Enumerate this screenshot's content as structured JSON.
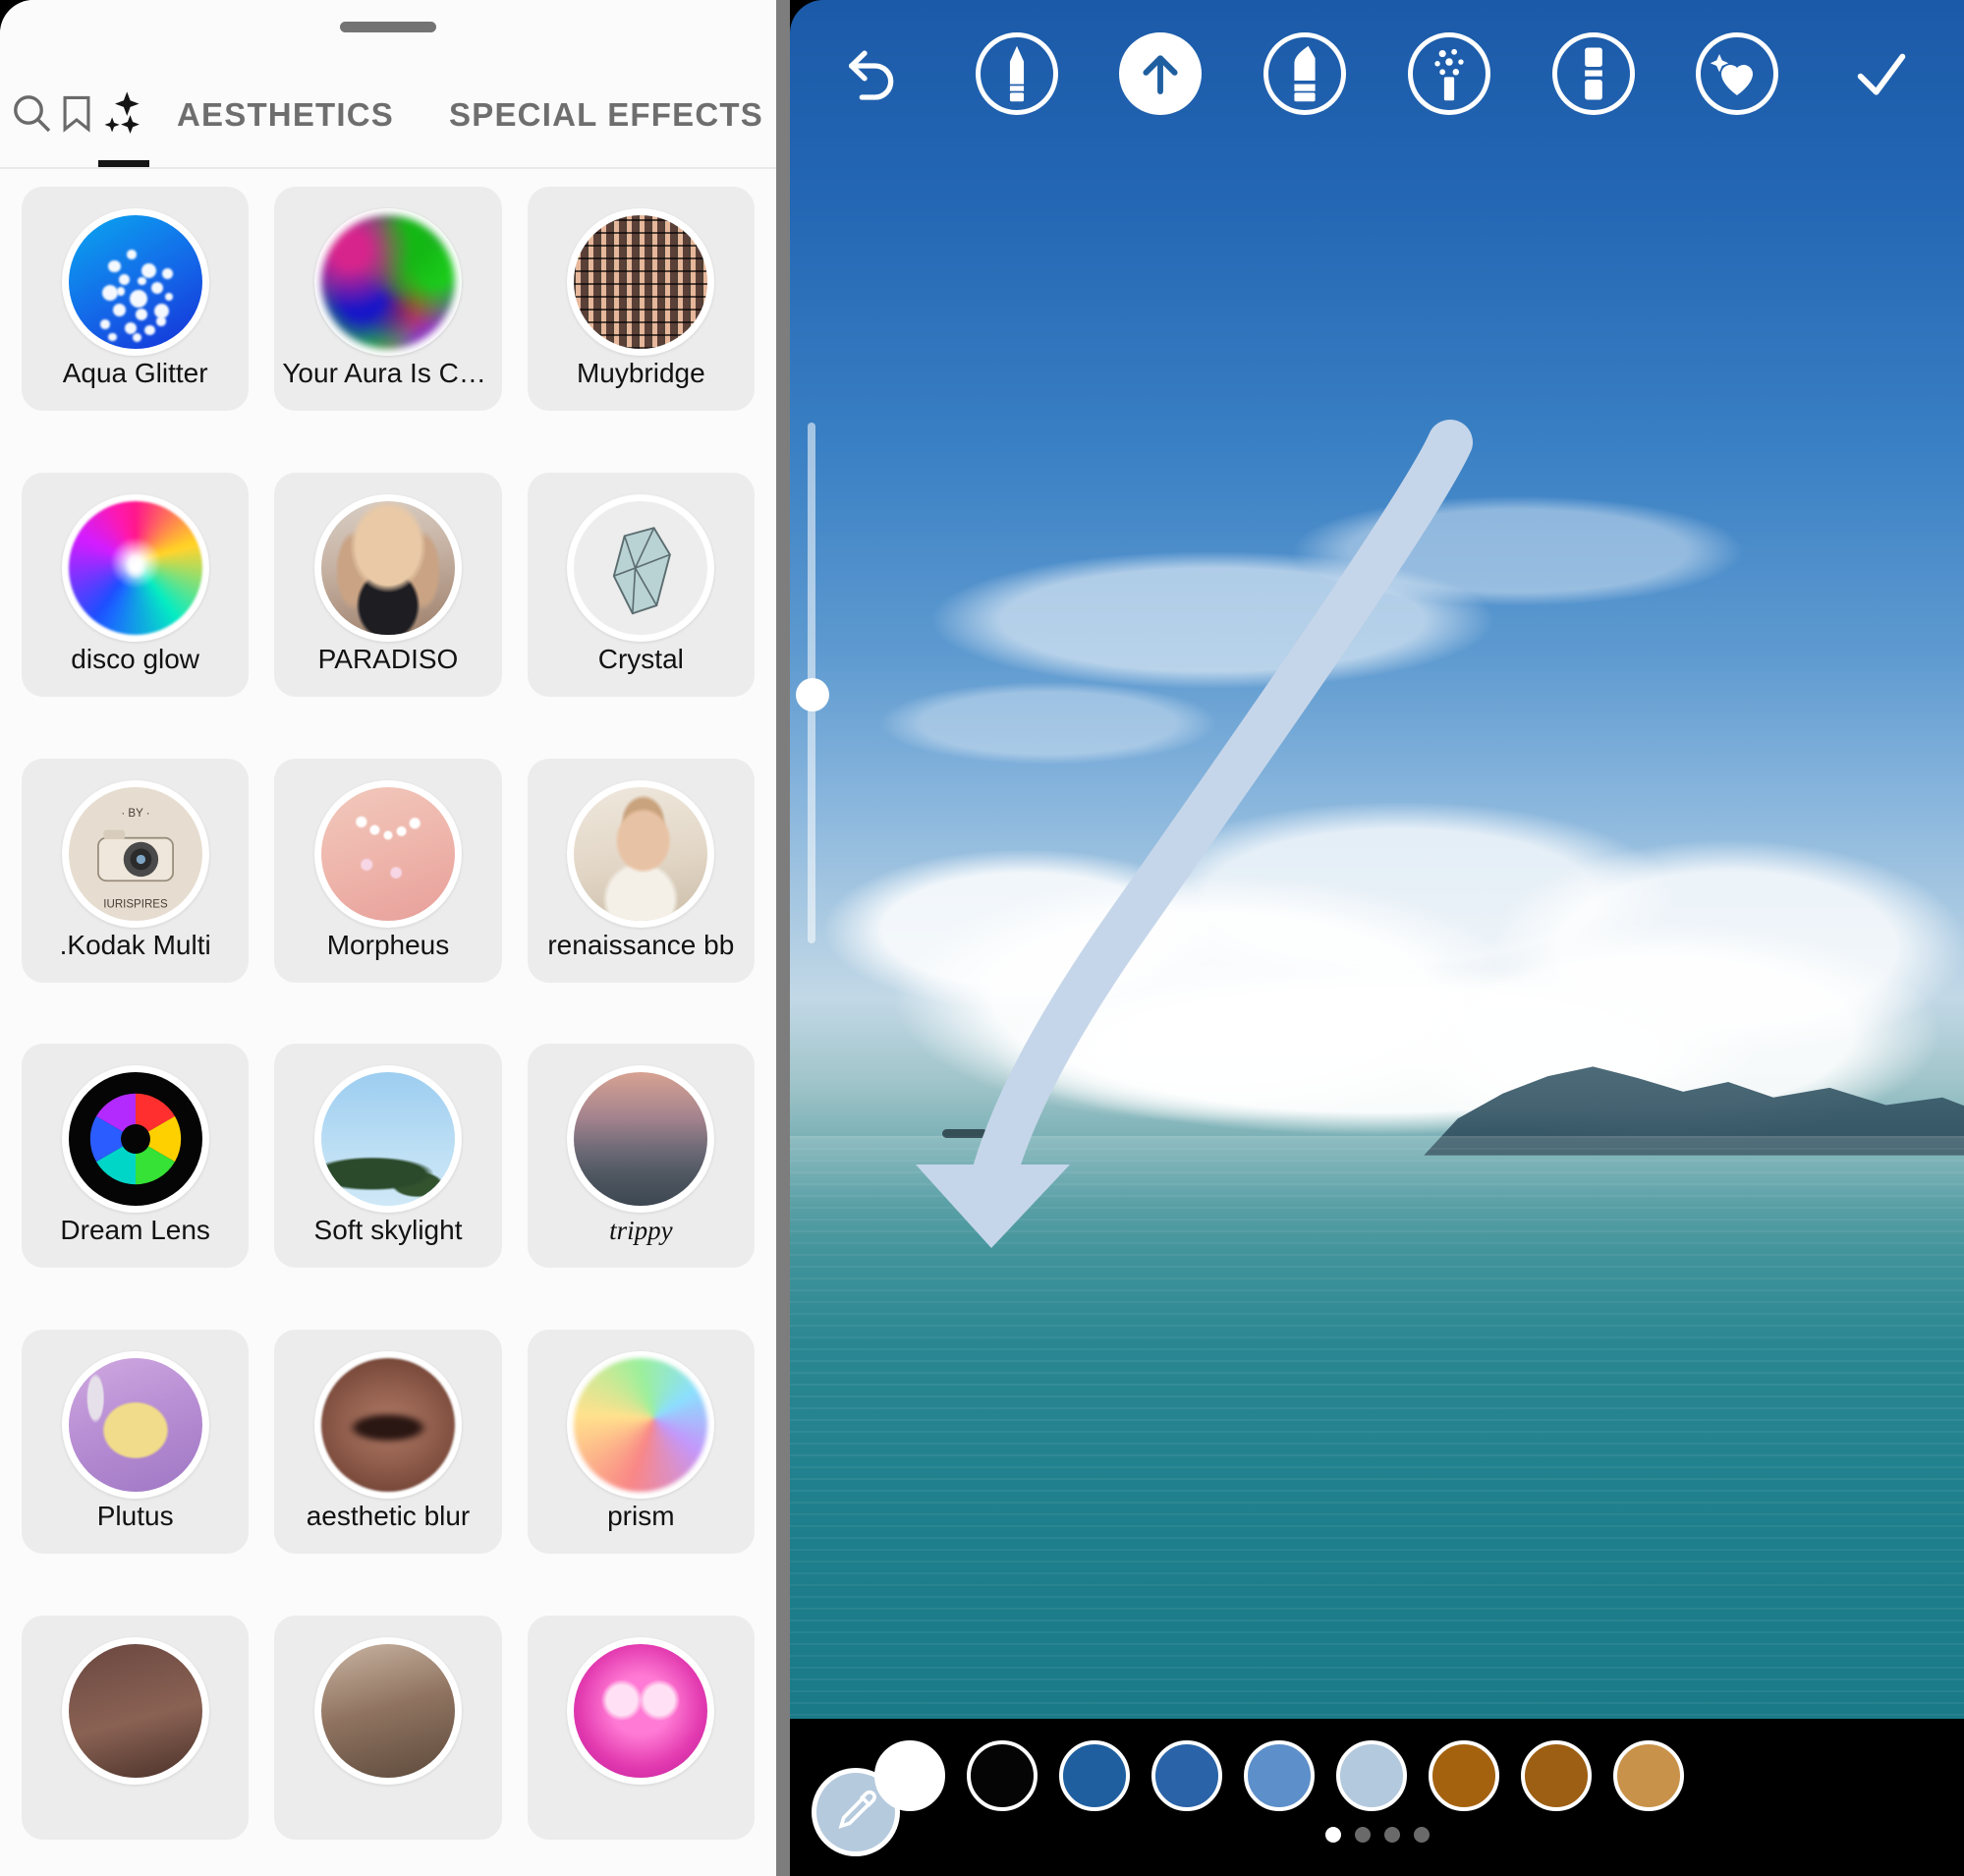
{
  "left_panel": {
    "grabber": "drag-handle",
    "tabs": [
      {
        "id": "search",
        "label": "",
        "icon": "search-icon",
        "active": false
      },
      {
        "id": "saved",
        "label": "",
        "icon": "bookmark-icon",
        "active": false
      },
      {
        "id": "effects",
        "label": "",
        "icon": "sparkles-icon",
        "active": true
      },
      {
        "id": "aesthetics",
        "label": "AESTHETICS",
        "icon": "",
        "active": false
      },
      {
        "id": "special-effects",
        "label": "SPECIAL EFFECTS",
        "icon": "",
        "active": false
      }
    ],
    "filters": [
      {
        "name": "Aqua Glitter",
        "art": "th-aqua",
        "script": false
      },
      {
        "name": "Your Aura Is Chan...",
        "art": "th-aura",
        "script": false
      },
      {
        "name": "Muybridge",
        "art": "th-muy",
        "script": false
      },
      {
        "name": "disco glow",
        "art": "th-disco",
        "script": false
      },
      {
        "name": "PARADISO",
        "art": "th-paradiso",
        "script": false
      },
      {
        "name": "Crystal",
        "art": "th-crystal",
        "script": false
      },
      {
        "name": ".Kodak Multi",
        "art": "th-kodak",
        "script": false
      },
      {
        "name": "Morpheus",
        "art": "th-morph",
        "script": false
      },
      {
        "name": "renaissance bb",
        "art": "th-renai",
        "script": false
      },
      {
        "name": "Dream Lens",
        "art": "th-dream",
        "script": false
      },
      {
        "name": "Soft skylight",
        "art": "th-soft",
        "script": false
      },
      {
        "name": "trippy",
        "art": "th-trippy",
        "script": true
      },
      {
        "name": "Plutus",
        "art": "th-plutus",
        "script": false
      },
      {
        "name": "aesthetic blur",
        "art": "th-ablur",
        "script": false
      },
      {
        "name": "prism",
        "art": "th-prism",
        "script": false
      },
      {
        "name": "",
        "art": "th-r6a",
        "script": false
      },
      {
        "name": "",
        "art": "th-r6b",
        "script": false
      },
      {
        "name": "",
        "art": "th-r6c",
        "script": false
      }
    ]
  },
  "editor": {
    "toolbar": [
      {
        "id": "undo",
        "icon": "undo-icon",
        "selected": false,
        "ringed": false
      },
      {
        "id": "pen",
        "icon": "pen-icon",
        "selected": false,
        "ringed": true
      },
      {
        "id": "arrow",
        "icon": "arrow-up-icon",
        "selected": true,
        "ringed": true
      },
      {
        "id": "marker",
        "icon": "marker-icon",
        "selected": false,
        "ringed": true
      },
      {
        "id": "glitter",
        "icon": "glitter-pen-icon",
        "selected": false,
        "ringed": true
      },
      {
        "id": "eraser",
        "icon": "eraser-icon",
        "selected": false,
        "ringed": true
      },
      {
        "id": "neon",
        "icon": "heart-sparkle-icon",
        "selected": false,
        "ringed": true
      },
      {
        "id": "done",
        "icon": "check-icon",
        "selected": false,
        "ringed": false
      }
    ],
    "colors": [
      {
        "name": "white",
        "hex": "#ffffff",
        "selected": true
      },
      {
        "name": "black",
        "hex": "#050505",
        "selected": false
      },
      {
        "name": "navy-blue",
        "hex": "#1f5fa0",
        "selected": false
      },
      {
        "name": "blue",
        "hex": "#2a63a8",
        "selected": false
      },
      {
        "name": "medium-blue",
        "hex": "#5d8fca",
        "selected": false
      },
      {
        "name": "light-blue",
        "hex": "#b3c9de",
        "selected": false
      },
      {
        "name": "brown",
        "hex": "#a4620f",
        "selected": false
      },
      {
        "name": "dark-brown",
        "hex": "#9d5f13",
        "selected": false
      },
      {
        "name": "tan",
        "hex": "#c9924a",
        "selected": false
      }
    ],
    "page_dots": {
      "count": 4,
      "active_index": 0
    },
    "eyedropper": "eyedropper-icon",
    "annotation": {
      "type": "arrow-stroke",
      "color": "#c6d6ea"
    },
    "brush_size_slider": {
      "value_percent": 50
    }
  }
}
